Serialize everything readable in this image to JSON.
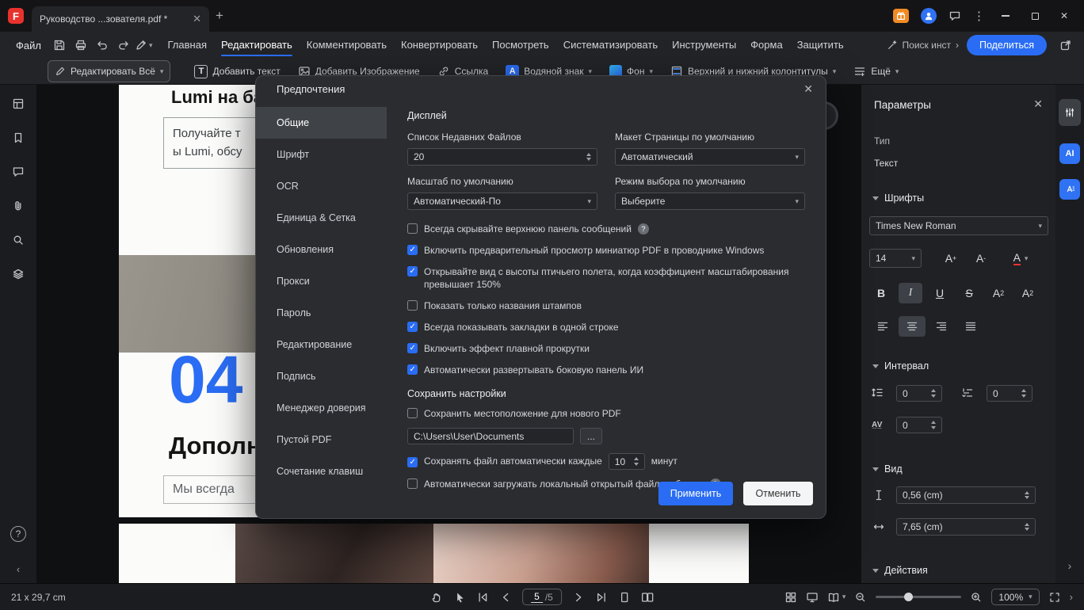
{
  "titlebar": {
    "tab_title": "Руководство ...зователя.pdf *"
  },
  "menubar": {
    "file_label": "Файл",
    "items": [
      {
        "label": "Главная"
      },
      {
        "label": "Редактировать"
      },
      {
        "label": "Комментировать"
      },
      {
        "label": "Конвертировать"
      },
      {
        "label": "Посмотреть"
      },
      {
        "label": "Систематизировать"
      },
      {
        "label": "Инструменты"
      },
      {
        "label": "Форма"
      },
      {
        "label": "Защитить"
      }
    ],
    "search_label": "Поиск инст",
    "share_label": "Поделиться"
  },
  "toolbar": {
    "edit_all": "Редактировать Всё",
    "add_text": "Добавить текст",
    "add_image": "Добавить Изображение",
    "link": "Ссылка",
    "watermark": "Водяной знак",
    "background": "Фон",
    "header_footer": "Верхний и нижний колонтитулы",
    "more": "Ещё"
  },
  "document": {
    "heading1": "Lumi на баз",
    "quote_line1": "Получайте т",
    "quote_line2": "ы Lumi, обсу",
    "chapter_number": "04",
    "heading2": "Дополн",
    "footer_line": "Мы всегда"
  },
  "dialog": {
    "title": "Предпочтения",
    "nav": [
      "Общие",
      "Шрифт",
      "OCR",
      "Единица & Сетка",
      "Обновления",
      "Прокси",
      "Пароль",
      "Редактирование",
      "Подпись",
      "Менеджер доверия",
      "Пустой PDF",
      "Сочетание клавиш"
    ],
    "sections": {
      "display": "Дисплей",
      "save": "Сохранить настройки"
    },
    "fields": {
      "recent_label": "Список Недавних Файлов",
      "recent_value": "20",
      "layout_label": "Макет Страницы по умолчанию",
      "layout_value": "Автоматический",
      "zoom_label": "Масштаб по умолчанию",
      "zoom_value": "Автоматический-По",
      "select_label": "Режим выбора по умолчанию",
      "select_value": "Выберите"
    },
    "checkboxes": [
      {
        "label": "Всегда скрывайте верхнюю панель сообщений",
        "checked": false
      },
      {
        "label": "Включить предварительный просмотр миниатюр PDF в проводнике Windows",
        "checked": true
      },
      {
        "label": "Открывайте вид с высоты птичьего полета, когда коэффициент масштабирования превышает 150%",
        "checked": true
      },
      {
        "label": "Показать только названия штампов",
        "checked": false
      },
      {
        "label": "Всегда показывать закладки в одной строке",
        "checked": true
      },
      {
        "label": "Включить эффект плавной прокрутки",
        "checked": true
      },
      {
        "label": "Автоматически развертывать боковую панель ИИ",
        "checked": true
      }
    ],
    "save_location": {
      "label": "Сохранить местоположение для нового PDF",
      "checked": false
    },
    "save_path": "C:\\Users\\User\\Documents",
    "browse_label": "...",
    "autosave": {
      "label": "Сохранять файл автоматически каждые",
      "checked": true,
      "value": "10",
      "unit": "минут"
    },
    "cloud": {
      "label": "Автоматически загружать локальный открытый файл в облако.",
      "checked": false
    },
    "apply_label": "Применить",
    "cancel_label": "Отменить"
  },
  "right_panel": {
    "title": "Параметры",
    "type_label": "Тип",
    "type_value": "Текст",
    "fonts_section": "Шрифты",
    "font_name": "Times New Roman",
    "font_size": "14",
    "size_buttons": [
      {
        "label": "A",
        "mark": "+"
      },
      {
        "label": "A",
        "mark": "-"
      },
      {
        "label": "A"
      }
    ],
    "format_buttons": [
      {
        "label": "B",
        "active": false
      },
      {
        "label": "I",
        "active": true
      },
      {
        "label": "U",
        "active": false
      },
      {
        "label": "S",
        "active": false
      },
      {
        "label": "A",
        "mark": "2",
        "active": false
      },
      {
        "label": "A",
        "mark": "2",
        "active": false
      }
    ],
    "spacing_section": "Интервал",
    "line_spacing": "0",
    "para_spacing": "0",
    "char_spacing": "0",
    "view_section": "Вид",
    "view_height": "0,56 (cm)",
    "view_width": "7,65 (cm)",
    "actions_section": "Действия"
  },
  "statusbar": {
    "page_size": "21 x 29,7 cm",
    "current_page": "5",
    "page_total": "/5",
    "zoom_value": "100%"
  },
  "colors": {
    "accent": "#2a6df4",
    "logo_red": "#e8322e"
  }
}
